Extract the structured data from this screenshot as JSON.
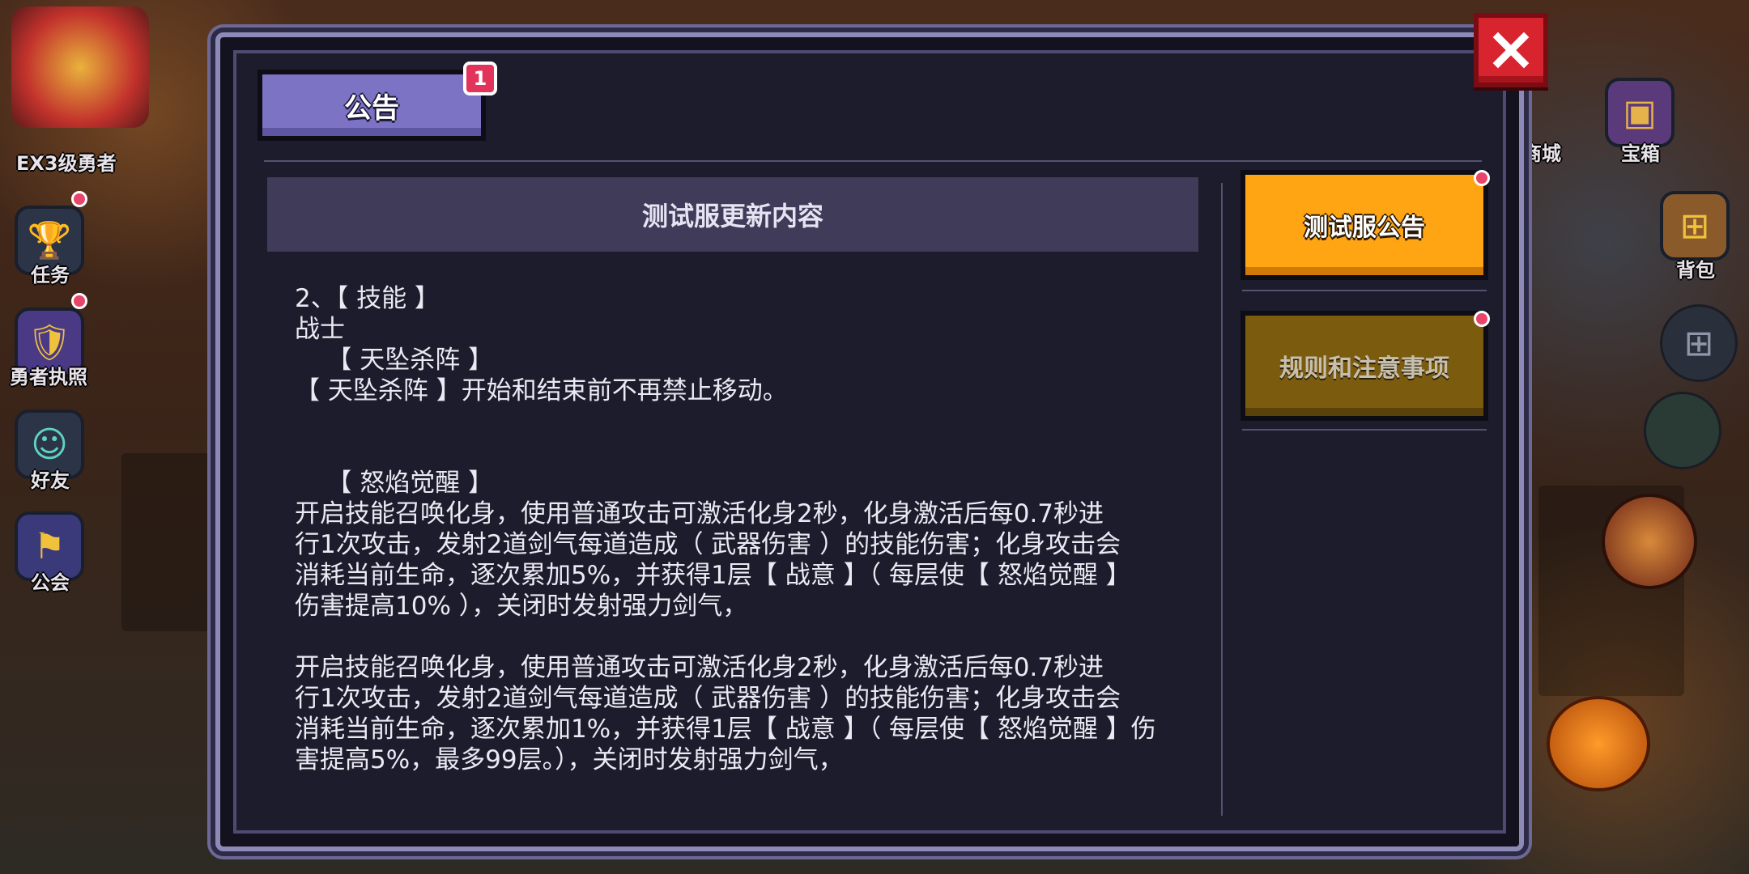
{
  "background": {
    "player_rank": "EX3级勇者",
    "left_menu": [
      {
        "label": "任务",
        "icon": "trophy-icon"
      },
      {
        "label": "勇者执照",
        "icon": "license-icon"
      },
      {
        "label": "好友",
        "icon": "friend-icon"
      },
      {
        "label": "公会",
        "icon": "guild-icon"
      }
    ],
    "right_menu": [
      {
        "label": "商城",
        "icon": "shop-icon"
      },
      {
        "label": "宝箱",
        "icon": "chest-icon"
      },
      {
        "label": "背包",
        "icon": "backpack-icon"
      }
    ]
  },
  "dialog": {
    "tab": {
      "label": "公告",
      "badge": "1"
    },
    "content_title": "测试服更新内容",
    "content_lines": [
      "2、【 技能 】",
      "战士",
      "    【 天坠杀阵 】",
      "【 天坠杀阵 】开始和结束前不再禁止移动。",
      "",
      "",
      "    【 怒焰觉醒 】",
      "开启技能召唤化身，使用普通攻击可激活化身2秒，化身激活后每0.7秒进",
      "行1次攻击，发射2道剑气每道造成（ 武器伤害 ）的技能伤害；化身攻击会",
      "消耗当前生命，逐次累加5%，并获得1层【 战意 】（ 每层使【 怒焰觉醒 】",
      "伤害提高10% ），关闭时发射强力剑气，",
      "",
      "开启技能召唤化身，使用普通攻击可激活化身2秒，化身激活后每0.7秒进",
      "行1次攻击，发射2道剑气每道造成（ 武器伤害 ）的技能伤害；化身攻击会",
      "消耗当前生命，逐次累加1%，并获得1层【 战意 】（ 每层使【 怒焰觉醒 】伤",
      "害提高5%，最多99层。），关闭时发射强力剑气，"
    ],
    "side_buttons": [
      {
        "label": "测试服公告",
        "state": "selected",
        "color": "#ffa514"
      },
      {
        "label": "规则和注意事项",
        "state": "unselected",
        "color": "#7b5b0e"
      }
    ],
    "close_icon": "close-icon"
  }
}
